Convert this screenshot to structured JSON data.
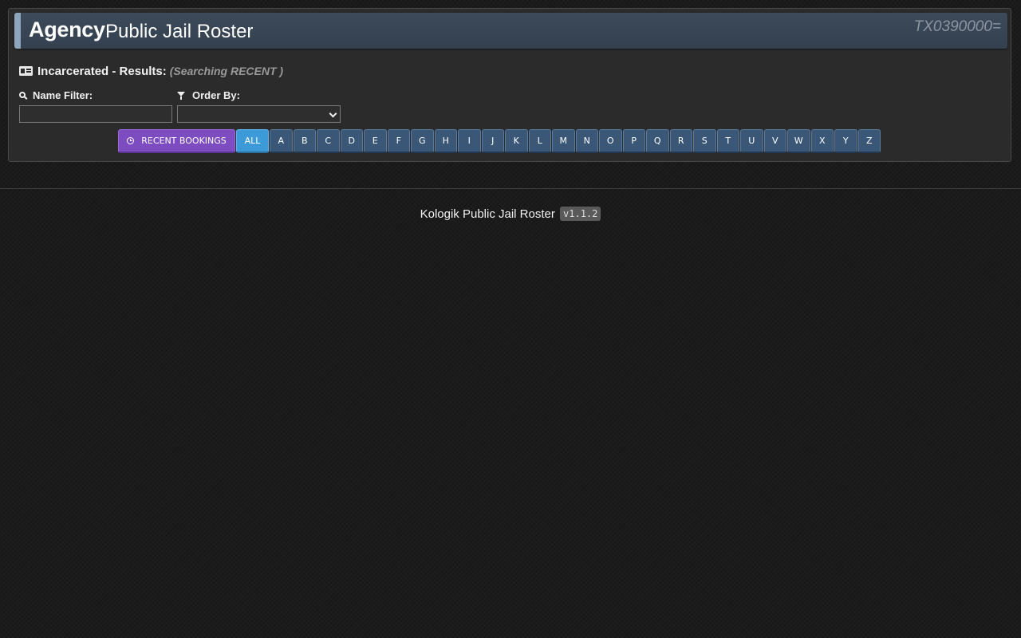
{
  "header": {
    "agency": "Agency",
    "title": "Public Jail Roster",
    "code": "TX0390000="
  },
  "results": {
    "label": "Incarcerated - Results:",
    "searching": "(Searching RECENT )"
  },
  "filters": {
    "name_label": "Name Filter:",
    "name_value": "",
    "order_label": "Order By:",
    "order_value": ""
  },
  "buttons": {
    "recent": "RECENT BOOKINGS",
    "all": "ALL",
    "letters": [
      "A",
      "B",
      "C",
      "D",
      "E",
      "F",
      "G",
      "H",
      "I",
      "J",
      "K",
      "L",
      "M",
      "N",
      "O",
      "P",
      "Q",
      "R",
      "S",
      "T",
      "U",
      "V",
      "W",
      "X",
      "Y",
      "Z"
    ]
  },
  "footer": {
    "text": "Kologik Public Jail Roster",
    "version": "v1.1.2"
  },
  "colors": {
    "recent_button": "#7d4cc0",
    "all_button": "#3d9ad8",
    "letter_button": "#3a5778",
    "header_bar": "#3c4a5a"
  }
}
